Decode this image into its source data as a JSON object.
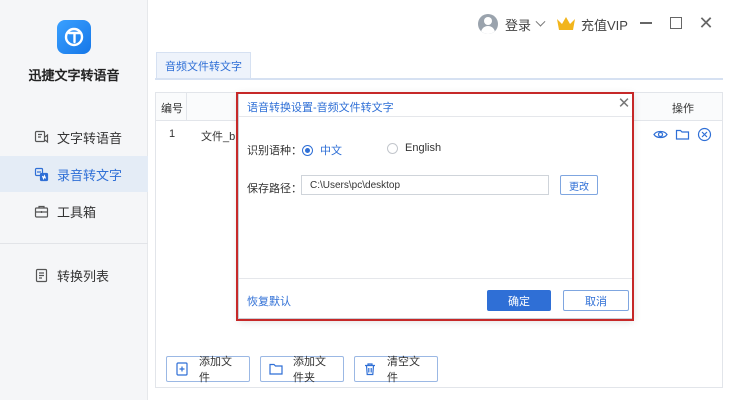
{
  "app": {
    "name": "迅捷文字转语音",
    "logo_icon": "logo-t-icon",
    "accent_color": "#2f6fd6",
    "highlight_color": "#c62828"
  },
  "sidebar": {
    "items": [
      {
        "label": "文字转语音",
        "icon": "text-to-speech-icon",
        "active": false
      },
      {
        "label": "录音转文字",
        "icon": "audio-to-text-icon",
        "active": true
      },
      {
        "label": "工具箱",
        "icon": "toolbox-icon",
        "active": false
      },
      {
        "label": "转换列表",
        "icon": "list-icon",
        "active": false
      }
    ]
  },
  "topbar": {
    "login_label": "登录",
    "vip_label": "充值VIP"
  },
  "tabs": [
    {
      "label": "音频文件转文字",
      "active": true
    }
  ],
  "table": {
    "headers": {
      "number": "编号",
      "operation": "操作"
    },
    "rows": [
      {
        "number": "1",
        "file": "文件_b"
      }
    ]
  },
  "actions": {
    "add_file": "添加文件",
    "add_folder": "添加文件夹",
    "clear_files": "清空文件"
  },
  "dialog": {
    "title": "语音转换设置-音频文件转文字",
    "language_label": "识别语种：",
    "options": {
      "chinese": "中文",
      "english": "English"
    },
    "selected_language": "中文",
    "path_label": "保存路径：",
    "path_value": "C:\\Users\\pc\\desktop",
    "change_button": "更改",
    "restore_default": "恢复默认",
    "ok_button": "确定",
    "cancel_button": "取消"
  }
}
